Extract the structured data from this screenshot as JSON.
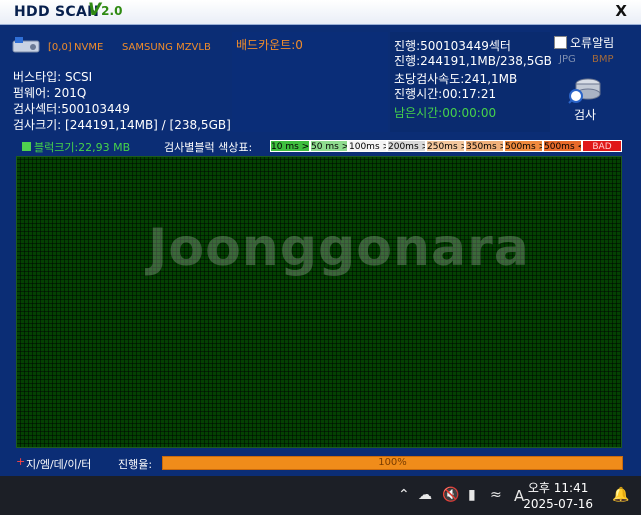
{
  "window": {
    "title": "HDD SCAN",
    "version_prefix": "V",
    "version": "2.0",
    "close_label": "X"
  },
  "disk": {
    "id": "[0,0]",
    "interface": "NVME",
    "model": "SAMSUNG MZVLB",
    "bus_type": "버스타입: SCSI",
    "firmware": "펌웨어: 201Q",
    "sectors": "검사섹터:500103449",
    "size": "검사크기: [244191,14MB] / [238,5GB]"
  },
  "bad_count": "배드카운트:0",
  "progress_info": {
    "sector": "진행:500103449섹터",
    "size": "진행:244191,1MB/238,5GB",
    "speed": "초당검사속도:241,1MB",
    "elapsed": "진행시간:00:17:21",
    "remaining": "남은시간:00:00:00"
  },
  "options": {
    "error_alarm": "오류알림",
    "jpg": "JPG",
    "bmp": "BMP",
    "scan_label": "검사"
  },
  "block_size": "블럭크기:22,93 MB",
  "legend_title": "검사별블럭 색상표:",
  "legend": [
    {
      "label": "10 ms >",
      "color": "#3fbf3f"
    },
    {
      "label": "50 ms >",
      "color": "#8fdc8f"
    },
    {
      "label": "100ms >",
      "color": "#f4f4f4"
    },
    {
      "label": "200ms >",
      "color": "#d9d9d9"
    },
    {
      "label": "250ms >",
      "color": "#f3c79d"
    },
    {
      "label": "350ms >",
      "color": "#f0b07a"
    },
    {
      "label": "500ms >",
      "color": "#f08a3e"
    },
    {
      "label": "500ms <",
      "color": "#e76a2a"
    },
    {
      "label": "BAD",
      "color": "#e01818"
    }
  ],
  "watermark": "Joonggonara",
  "footer": {
    "brand": "지/엠/데/이/터",
    "progress_label": "진행율:",
    "progress_text": "100%",
    "progress": 1.0
  },
  "taskbar": {
    "ampm_time": "오후 11:41",
    "date": "2025-07-16",
    "ime": "A"
  }
}
